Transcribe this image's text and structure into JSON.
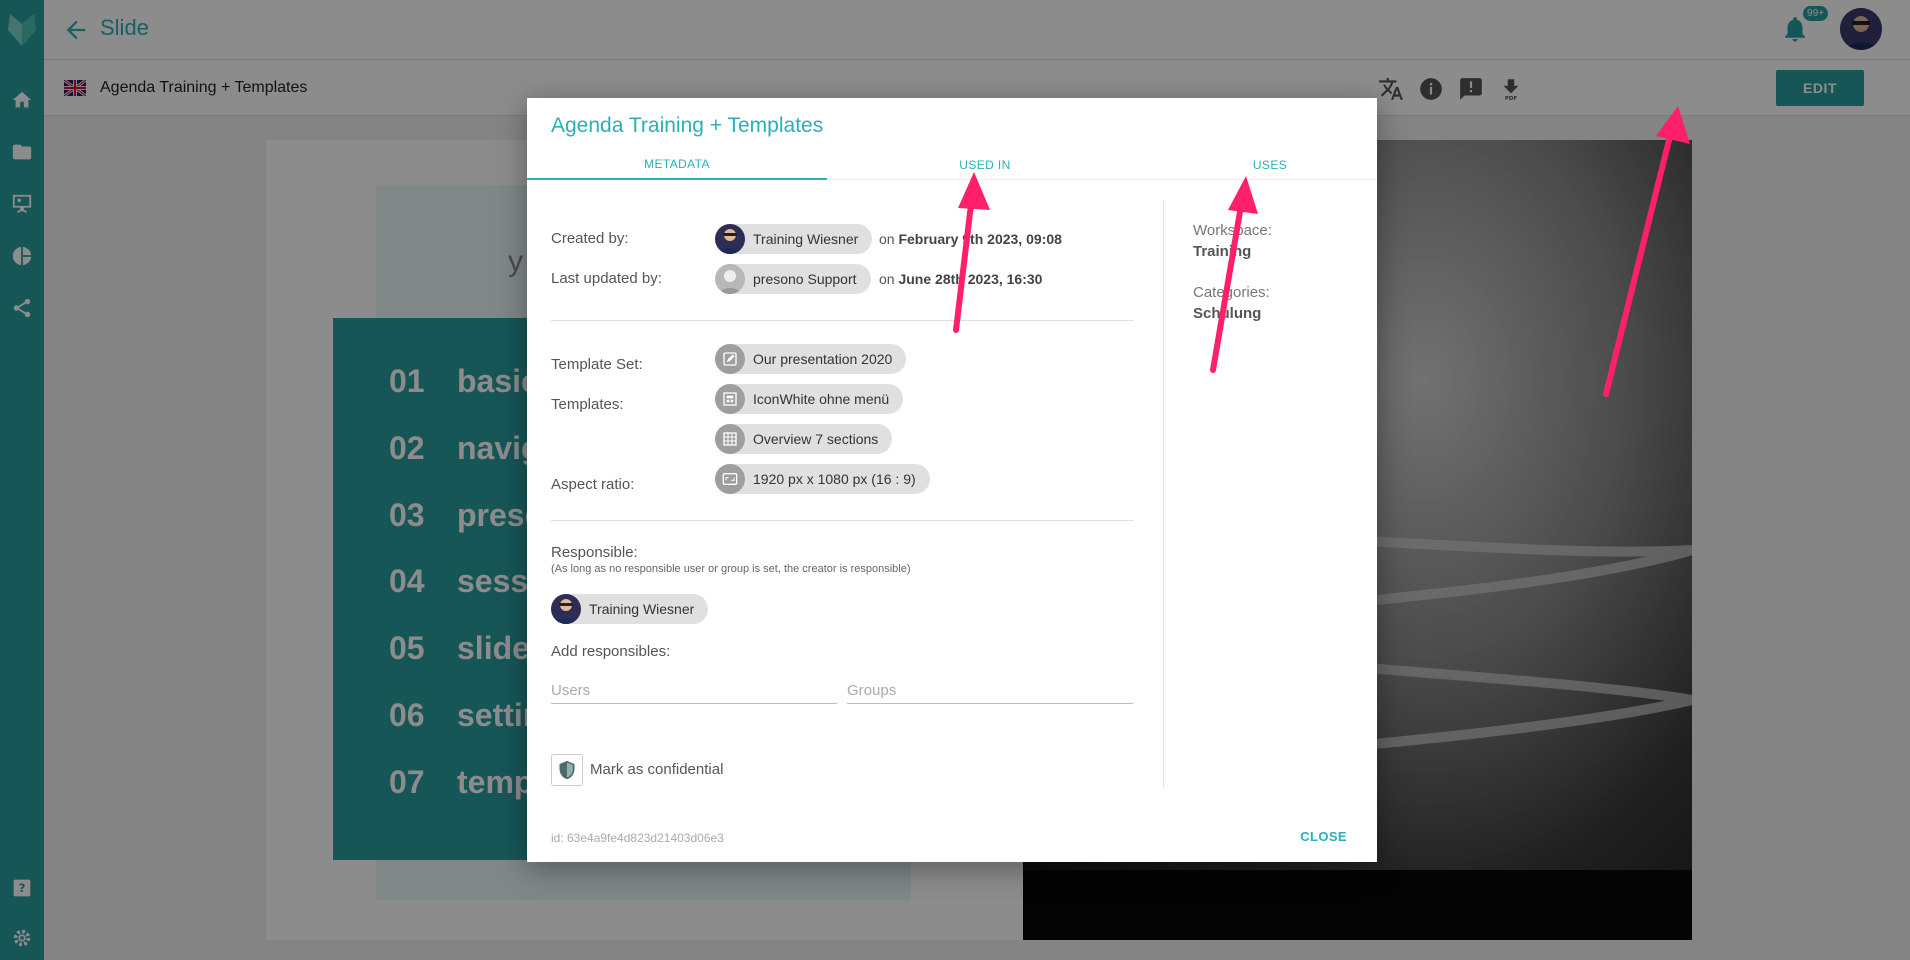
{
  "app": {
    "title": "Slide",
    "notification_count": "99+"
  },
  "toolbar": {
    "document_title": "Agenda Training + Templates",
    "edit_label": "EDIT"
  },
  "slide": {
    "agenda": [
      {
        "num": "01",
        "text": "basic"
      },
      {
        "num": "02",
        "text": "navig"
      },
      {
        "num": "03",
        "text": "prese"
      },
      {
        "num": "04",
        "text": "sessi"
      },
      {
        "num": "05",
        "text": "slide"
      },
      {
        "num": "06",
        "text": "settin"
      },
      {
        "num": "07",
        "text": "temp"
      }
    ],
    "fragment": "y"
  },
  "modal": {
    "title": "Agenda Training + Templates",
    "tabs": [
      "METADATA",
      "USED IN",
      "USES"
    ],
    "created_label": "Created by:",
    "created_user": "Training Wiesner",
    "created_on_prefix": "on",
    "created_on": "February 9th 2023, 09:08",
    "updated_label": "Last updated by:",
    "updated_user": "presono Support",
    "updated_on_prefix": "on",
    "updated_on": "June 28th 2023, 16:30",
    "template_set_label": "Template Set:",
    "template_set": "Our presentation 2020",
    "templates_label": "Templates:",
    "templates": [
      "IconWhite ohne menü",
      "Overview 7 sections"
    ],
    "aspect_label": "Aspect ratio:",
    "aspect": "1920 px x 1080 px (16 : 9)",
    "responsible_label": "Responsible:",
    "responsible_note": "(As long as no responsible user or group is set, the creator is responsible)",
    "responsible_user": "Training Wiesner",
    "add_responsibles_label": "Add responsibles:",
    "users_placeholder": "Users",
    "groups_placeholder": "Groups",
    "confidential_label": "Mark as confidential",
    "workspace_label": "Workspace:",
    "workspace": "Training",
    "categories_label": "Categories:",
    "categories": "Schulung",
    "id": "id: 63e4a9fe4d823d21403d06e3",
    "close_label": "CLOSE"
  },
  "colors": {
    "accent": "#2ab0b5",
    "sidebar": "#2a9d9f",
    "arrow": "#ff1f6b"
  }
}
